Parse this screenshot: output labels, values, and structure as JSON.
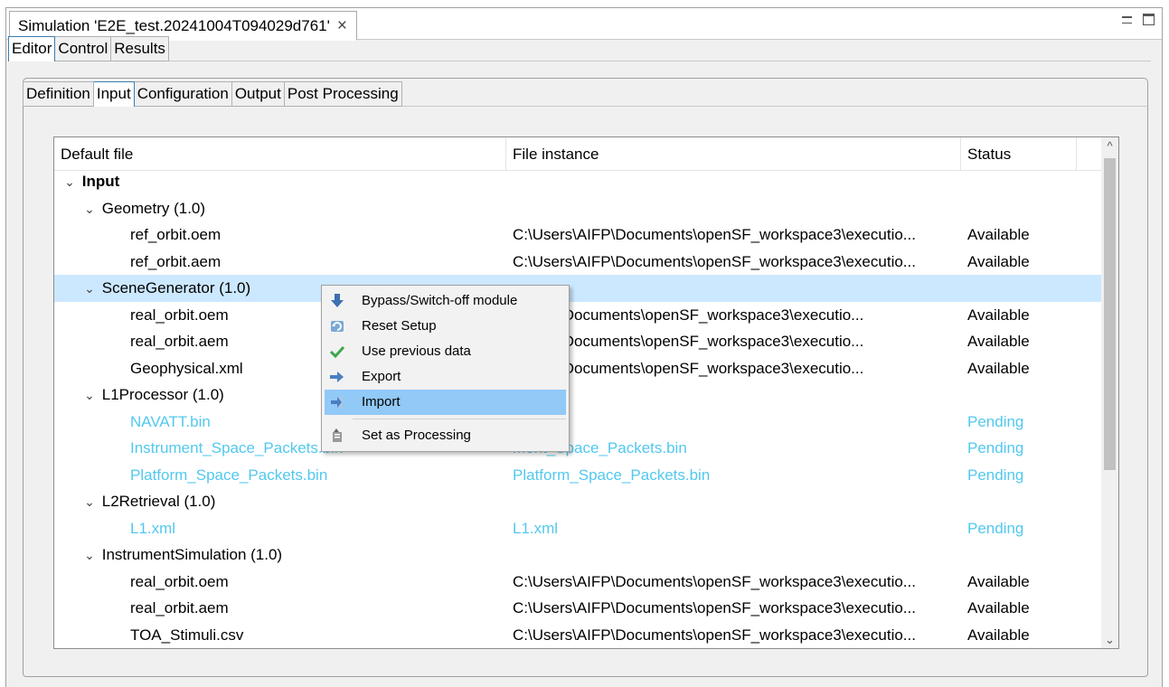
{
  "view_tab": {
    "title": "Simulation 'E2E_test.20241004T094029d761'",
    "close": "×"
  },
  "main_tabs": [
    "Editor",
    "Control",
    "Results"
  ],
  "sub_tabs": [
    "Definition",
    "Input",
    "Configuration",
    "Output",
    "Post Processing"
  ],
  "table": {
    "headers": {
      "default_file": "Default file",
      "file_instance": "File instance",
      "status": "Status"
    },
    "rows": [
      {
        "level": 0,
        "expand": "⌄",
        "default": "Input",
        "file": "",
        "status": ""
      },
      {
        "level": 1,
        "expand": "⌄",
        "default": "Geometry (1.0)",
        "file": "",
        "status": ""
      },
      {
        "level": 2,
        "default": "ref_orbit.oem",
        "file": "C:\\Users\\AIFP\\Documents\\openSF_workspace3\\executio...",
        "status": "Available"
      },
      {
        "level": 2,
        "default": "ref_orbit.aem",
        "file": "C:\\Users\\AIFP\\Documents\\openSF_workspace3\\executio...",
        "status": "Available"
      },
      {
        "level": 1,
        "expand": "⌄",
        "default": "SceneGenerator (1.0)",
        "file": "",
        "status": ""
      },
      {
        "level": 2,
        "default": "real_orbit.oem",
        "file": "s\\AIFP\\Documents\\openSF_workspace3\\executio...",
        "status": "Available"
      },
      {
        "level": 2,
        "default": "real_orbit.aem",
        "file": "s\\AIFP\\Documents\\openSF_workspace3\\executio...",
        "status": "Available"
      },
      {
        "level": 2,
        "default": "Geophysical.xml",
        "file": "s\\AIFP\\Documents\\openSF_workspace3\\executio...",
        "status": "Available"
      },
      {
        "level": 1,
        "expand": "⌄",
        "default": "L1Processor (1.0)",
        "file": "",
        "status": ""
      },
      {
        "level": 2,
        "default": "NAVATT.bin",
        "file": "T.bin",
        "status": "Pending"
      },
      {
        "level": 2,
        "default": "Instrument_Space_Packets.bin",
        "file": "ment_Space_Packets.bin",
        "status": "Pending"
      },
      {
        "level": 2,
        "default": "Platform_Space_Packets.bin",
        "file": "Platform_Space_Packets.bin",
        "status": "Pending"
      },
      {
        "level": 1,
        "expand": "⌄",
        "default": "L2Retrieval (1.0)",
        "file": "",
        "status": ""
      },
      {
        "level": 2,
        "default": "L1.xml",
        "file": "L1.xml",
        "status": "Pending"
      },
      {
        "level": 1,
        "expand": "⌄",
        "default": "InstrumentSimulation (1.0)",
        "file": "",
        "status": ""
      },
      {
        "level": 2,
        "default": "real_orbit.oem",
        "file": "C:\\Users\\AIFP\\Documents\\openSF_workspace3\\executio...",
        "status": "Available"
      },
      {
        "level": 2,
        "default": "real_orbit.aem",
        "file": "C:\\Users\\AIFP\\Documents\\openSF_workspace3\\executio...",
        "status": "Available"
      },
      {
        "level": 2,
        "default": "TOA_Stimuli.csv",
        "file": "C:\\Users\\AIFP\\Documents\\openSF_workspace3\\executio...",
        "status": "Available"
      }
    ]
  },
  "context_menu": {
    "items": [
      {
        "label": "Bypass/Switch-off module",
        "icon": "arrow-down-icon"
      },
      {
        "label": "Reset Setup",
        "icon": "reset-icon"
      },
      {
        "label": "Use previous data",
        "icon": "checkmark-icon"
      },
      {
        "label": "Export",
        "icon": "export-arrow-icon"
      },
      {
        "label": "Import",
        "icon": "import-arrow-icon"
      },
      {
        "label": "Set as Processing",
        "icon": "processing-icon"
      }
    ]
  },
  "colors": {
    "selected_row": "#cce8ff",
    "pending_text": "#52c8ee",
    "menu_highlight": "#91c9f7"
  }
}
